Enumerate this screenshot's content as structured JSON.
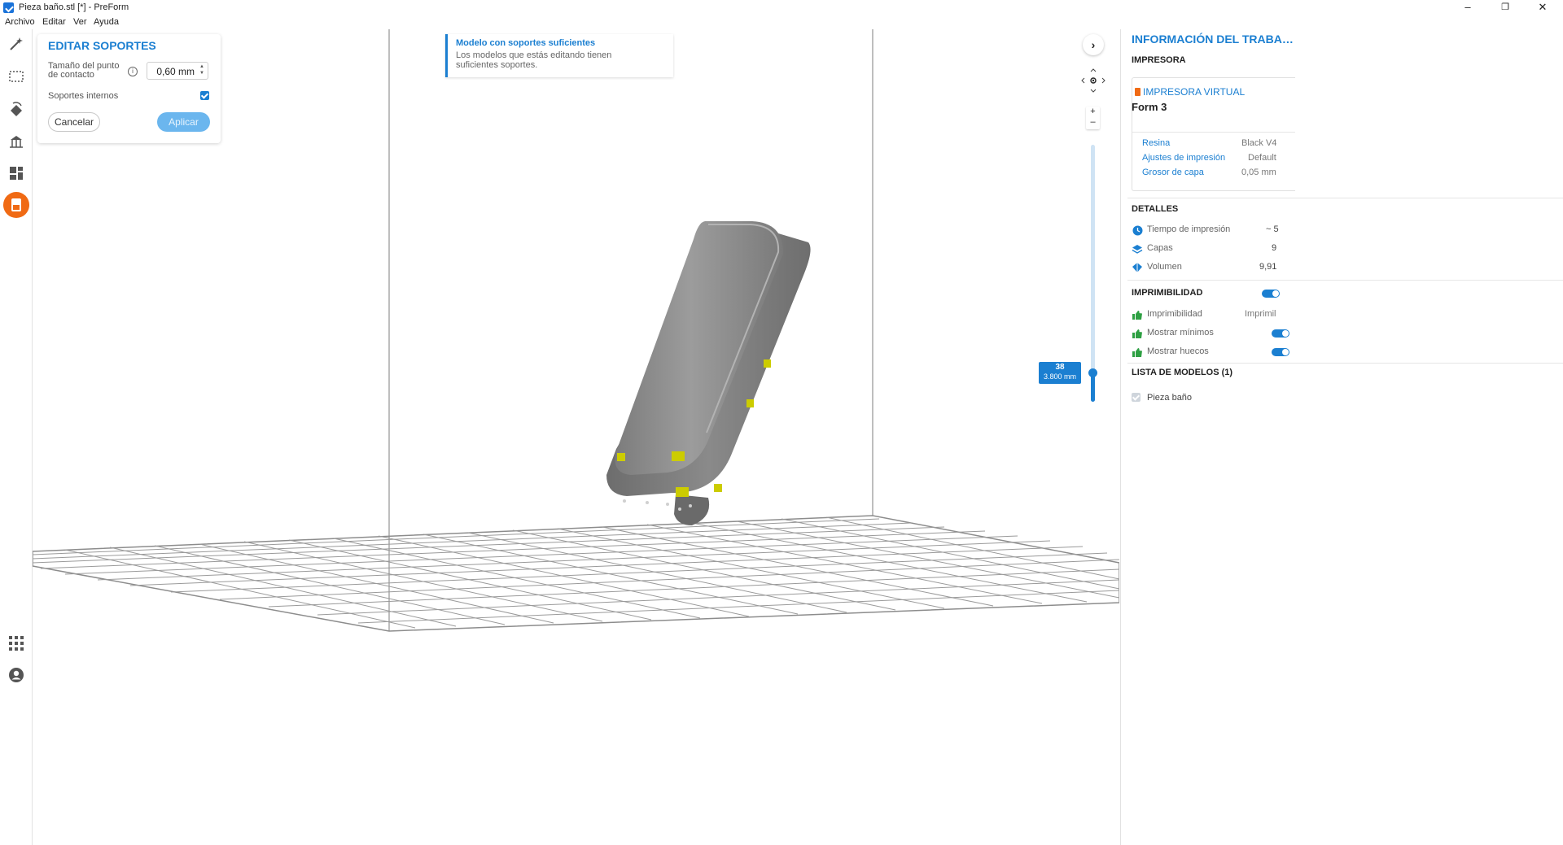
{
  "window": {
    "title": "Pieza baño.stl [*] - PreForm",
    "controls": {
      "minimize": "–",
      "maximize": "❐",
      "close": "✕"
    }
  },
  "menu": {
    "items": [
      "Archivo",
      "Editar",
      "Ver",
      "Ayuda"
    ]
  },
  "toolbar": {
    "tools": [
      "magic-wand-icon",
      "select-box-icon",
      "orient-icon",
      "supports-tool-icon",
      "layout-icon",
      "print-job-icon"
    ],
    "bottom": [
      "apps-grid-icon",
      "account-icon"
    ],
    "accent": "#f06a14"
  },
  "edit_supports": {
    "title": "EDITAR SOPORTES",
    "contact_point_label": "Tamaño del punto de contacto",
    "contact_point_value": "0,60 mm",
    "internal_supports_label": "Soportes internos",
    "internal_supports_checked": true,
    "cancel_label": "Cancelar",
    "apply_label": "Aplicar"
  },
  "notice": {
    "title": "Modelo con soportes suficientes",
    "body": "Los modelos que estás editando tienen suficientes soportes."
  },
  "viewport": {
    "collapse_glyph": "›",
    "zoom_in": "+",
    "zoom_out": "–",
    "layer_number": "38",
    "layer_height": "3.800 mm"
  },
  "info_panel": {
    "title": "INFORMACIÓN DEL TRABA…",
    "printer_section": "IMPRESORA",
    "printer_type": "IMPRESORA VIRTUAL",
    "printer_name": "Form 3",
    "resin_label": "Resina",
    "resin_value": "Black V4",
    "settings_label": "Ajustes de impresión",
    "settings_value": "Default",
    "layer_label": "Grosor de capa",
    "layer_value": "0,05 mm",
    "details_section": "DETALLES",
    "print_time_label": "Tiempo de impresión",
    "print_time_value": "~ 5",
    "layers_label": "Capas",
    "layers_value": "9",
    "volume_label": "Volumen",
    "volume_value": "9,91",
    "printability_section": "IMPRIMIBILIDAD",
    "printability_label": "Imprimibilidad",
    "printability_value": "Imprimil",
    "show_min_label": "Mostrar mínimos",
    "show_holes_label": "Mostrar huecos",
    "models_section": "LISTA DE MODELOS (1)",
    "model_name": "Pieza baño",
    "brand_color": "#1b7fd1"
  }
}
